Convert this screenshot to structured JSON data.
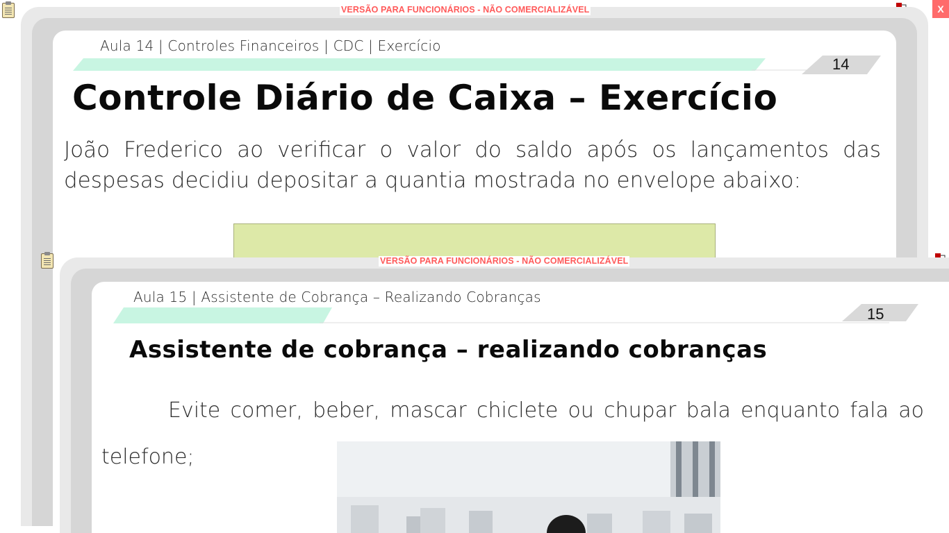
{
  "watermark": "VERSÃO PARA FUNCIONÁRIOS - NÃO COMERCIALIZÁVEL",
  "close_label": "X",
  "slide1": {
    "breadcrumb": "Aula 14 | Controles Financeiros | CDC | Exercício",
    "page_number": "14",
    "title": "Controle Diário de Caixa – Exercício",
    "body": "João Frederico ao verificar o valor do saldo após os lançamentos das despesas decidiu depositar a quantia mostrada no envelope abaixo:"
  },
  "slide2": {
    "breadcrumb": "Aula 15 | Assistente de Cobrança – Realizando Cobranças",
    "page_number": "15",
    "title": "Assistente de cobrança – realizando cobranças",
    "body": "Evite comer, beber, mascar chiclete ou chupar bala enquanto fala ao telefone;"
  },
  "icons": {
    "clipboard": "clipboard-icon",
    "network": "network-icon",
    "close": "close-icon"
  },
  "colors": {
    "watermark": "#ff5a5a",
    "close_button": "#ff6b6b",
    "ribbon": "#c8f5e2",
    "envelope": "#dde9a8",
    "frame": "#e9e9e9"
  }
}
